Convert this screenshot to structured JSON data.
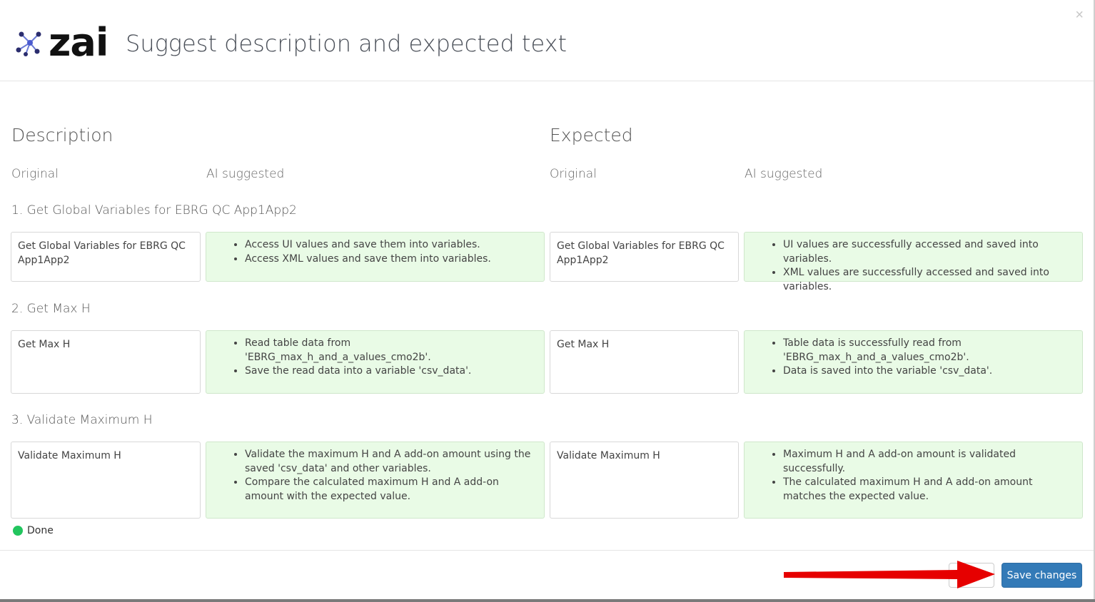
{
  "header": {
    "logo_text": "zai",
    "title": "Suggest description and expected text",
    "close_symbol": "×"
  },
  "sections": {
    "description": "Description",
    "expected": "Expected",
    "original_label": "Original",
    "ai_label": "AI suggested"
  },
  "steps": [
    {
      "title": "1. Get Global Variables for EBRG QC App1App2",
      "desc_original": "Get Global Variables for EBRG QC App1App2",
      "desc_ai": [
        "Access UI values and save them into variables.",
        "Access XML values and save them into variables."
      ],
      "exp_original": "Get Global Variables for EBRG QC App1App2",
      "exp_ai": [
        "UI values are successfully accessed and saved into variables.",
        "XML values are successfully accessed and saved into variables."
      ]
    },
    {
      "title": "2. Get Max H",
      "desc_original": "Get Max H",
      "desc_ai": [
        "Read table data from 'EBRG_max_h_and_a_values_cmo2b'.",
        "Save the read data into a variable 'csv_data'."
      ],
      "exp_original": "Get Max H",
      "exp_ai": [
        "Table data is successfully read from 'EBRG_max_h_and_a_values_cmo2b'.",
        "Data is saved into the variable 'csv_data'."
      ]
    },
    {
      "title": "3. Validate Maximum H",
      "desc_original": "Validate Maximum H",
      "desc_ai": [
        "Validate the maximum H and A add-on amount using the saved 'csv_data' and other variables.",
        "Compare the calculated maximum H and A add-on amount with the expected value."
      ],
      "exp_original": "Validate Maximum H",
      "exp_ai": [
        "Maximum H and A add-on amount is validated successfully.",
        "The calculated maximum H and A add-on amount matches the expected value."
      ]
    }
  ],
  "status": {
    "text": "Done",
    "color": "#22c55e"
  },
  "footer": {
    "cancel_label": "",
    "save_label": "Save changes"
  },
  "colors": {
    "accent": "#337ab7",
    "ai_background": "#e9fbe6",
    "annotation_arrow": "#e60000"
  }
}
